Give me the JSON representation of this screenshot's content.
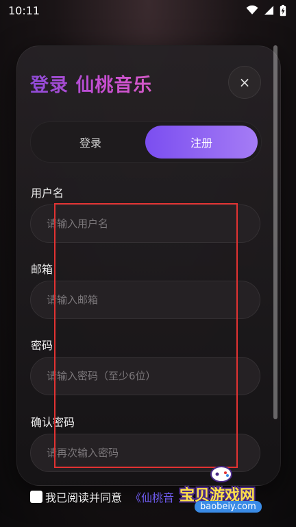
{
  "status_bar": {
    "time": "10:11",
    "icons": [
      "wifi-icon",
      "signal-icon",
      "battery-charging-icon"
    ]
  },
  "dialog": {
    "title": "登录 仙桃音乐",
    "close_label": "×"
  },
  "tabs": [
    {
      "label": "登录",
      "active": false
    },
    {
      "label": "注册",
      "active": true
    }
  ],
  "form": {
    "username": {
      "label": "用户名",
      "placeholder": "请输入用户名",
      "value": ""
    },
    "email": {
      "label": "邮箱",
      "placeholder": "请输入邮箱",
      "value": ""
    },
    "password": {
      "label": "密码",
      "placeholder": "请输入密码（至少6位）",
      "value": ""
    },
    "confirm_password": {
      "label": "确认密码",
      "placeholder": "请再次输入密码",
      "value": ""
    }
  },
  "agreement": {
    "text": "我已阅读并同意",
    "link_text": "《仙桃音"
  },
  "watermark": {
    "text": "宝贝游戏网",
    "url": "baobeiy.com"
  },
  "colors": {
    "accent_start": "#7b4ef0",
    "accent_end": "#a57cf5",
    "title_gradient_start": "#8e4bd8",
    "title_gradient_end": "#d45ac8",
    "highlight_box": "#e23232"
  }
}
